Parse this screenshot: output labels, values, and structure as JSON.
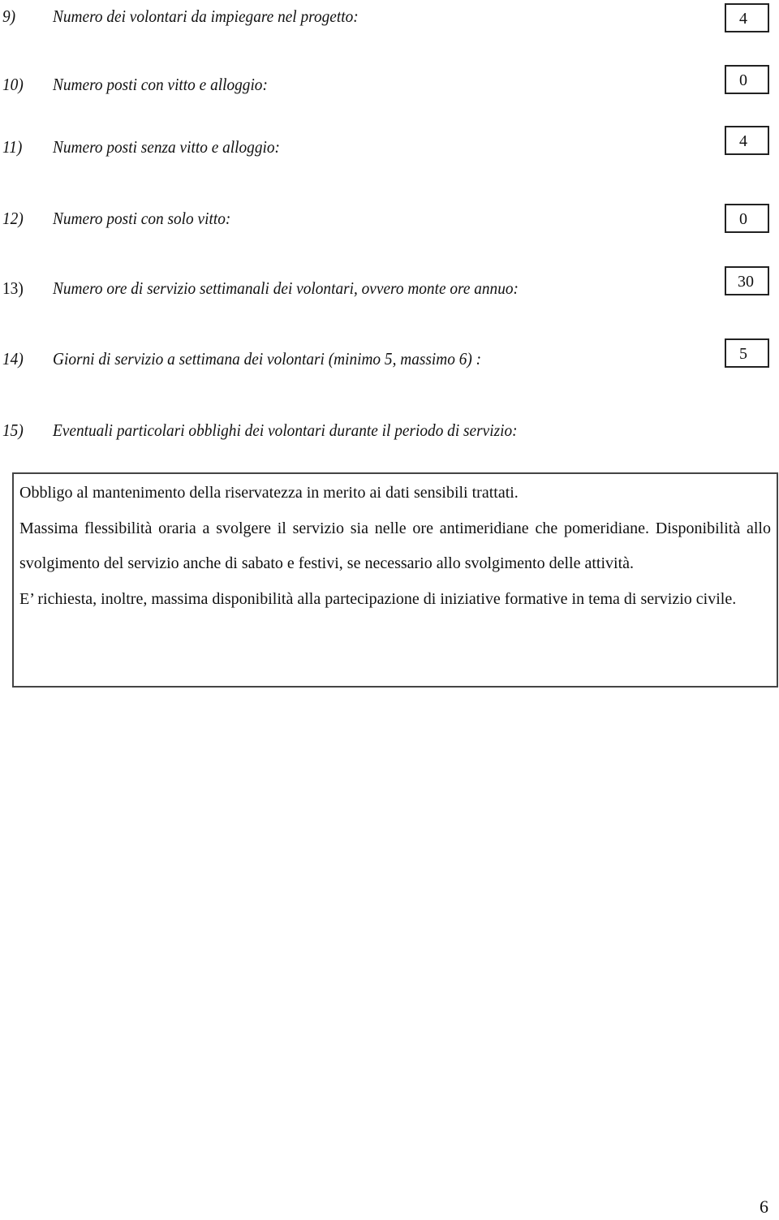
{
  "questions": [
    {
      "number": "9)",
      "label": "Numero dei volontari da impiegare nel progetto:",
      "value": "4"
    },
    {
      "number": "10)",
      "label": "Numero posti con vitto e alloggio:",
      "value": "0"
    },
    {
      "number": "11)",
      "label": "Numero posti senza vitto e alloggio:",
      "value": "4"
    },
    {
      "number": "12)",
      "label": "Numero posti con solo vitto:",
      "value": "0"
    },
    {
      "number": "13)",
      "label": "Numero ore di servizio settimanali dei volontari, ovvero monte ore annuo:",
      "value": "30"
    },
    {
      "number": "14)",
      "label": "Giorni di servizio a settimana dei volontari (minimo 5, massimo 6) :",
      "value": "5"
    },
    {
      "number": "15)",
      "label": "Eventuali particolari obblighi dei volontari durante il periodo di servizio:"
    }
  ],
  "obligations": [
    "Obbligo al mantenimento della riservatezza in merito ai dati sensibili trattati.",
    "Massima flessibilità oraria a svolgere il servizio sia nelle ore antimeridiane che pomeridiane. Disponibilità allo svolgimento del servizio anche di sabato e festivi, se necessario allo svolgimento delle attività.",
    "E’ richiesta, inoltre, massima disponibilità alla partecipazione di iniziative formative in tema di servizio civile."
  ],
  "page_number": "6"
}
